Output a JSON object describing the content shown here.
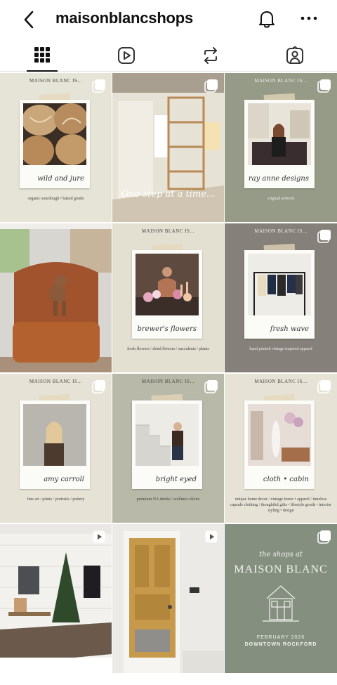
{
  "header": {
    "username": "maisonblancshops"
  },
  "tabs": [
    {
      "name": "grid",
      "icon": "grid-icon",
      "active": true
    },
    {
      "name": "reels",
      "icon": "reels-icon",
      "active": false
    },
    {
      "name": "reposts",
      "icon": "repost-icon",
      "active": false
    },
    {
      "name": "tagged",
      "icon": "tagged-person-icon",
      "active": false
    }
  ],
  "posts": {
    "p1": {
      "brand": "MAISON BLANC IS...",
      "caption": "wild and jure",
      "subtitle": "organic sourdough • baked goods"
    },
    "p2": {
      "overlay": "One step at a time..."
    },
    "p3": {
      "brand": "MAISON BLANC IS...",
      "caption": "ray anne designs",
      "subtitle": "original artwork"
    },
    "p5": {
      "brand": "MAISON BLANC IS...",
      "caption": "brewer's flowers",
      "subtitle": "fresh flowers / dried flowers / succulents / plants"
    },
    "p6": {
      "brand": "MAISON BLANC IS...",
      "caption": "fresh wave",
      "subtitle": "hand printed vintage inspired apparel"
    },
    "p7": {
      "brand": "MAISON BLANC IS...",
      "caption": "amy carroll",
      "subtitle": "fine art / prints / portraits / pottery"
    },
    "p8": {
      "brand": "MAISON BLANC IS...",
      "caption": "bright eyed",
      "subtitle": "premium NA drinks / wellness elixirs"
    },
    "p9": {
      "brand": "MAISON BLANC IS...",
      "caption": "cloth • cabin",
      "subtitle": "unique home decor / vintage home • apparel / timeless capsule clothing / thoughtful gifts • lifestyle goods • interior styling • design"
    },
    "p12": {
      "script": "the shops at",
      "main": "MAISON BLANC",
      "date": "FEBRUARY 2026",
      "location": "DOWNTOWN ROCKFORD"
    }
  },
  "colors": {
    "accent": "#111111",
    "sage": "#858f80",
    "cream": "#e8e6d9"
  }
}
